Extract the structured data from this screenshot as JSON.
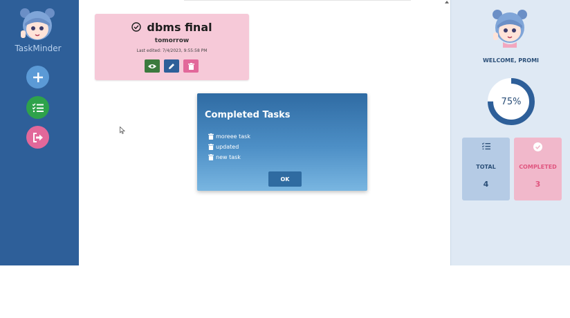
{
  "app": {
    "title": "TaskMinder"
  },
  "sidebar": {
    "buttons": [
      {
        "name": "add",
        "icon": "plus-icon",
        "color": "#5b9ad6"
      },
      {
        "name": "tasks",
        "icon": "checklist-icon",
        "color": "#2ea24b"
      },
      {
        "name": "logout",
        "icon": "sign-out-icon",
        "color": "#e2689a"
      }
    ]
  },
  "task_card": {
    "title": "dbms final",
    "due": "tomorrow",
    "edited": "Last edited: 7/4/2023, 9:55:58 PM",
    "status_icon": "check-circle-icon",
    "actions": [
      {
        "name": "view",
        "icon": "eye-icon",
        "color": "#3c7a3e"
      },
      {
        "name": "edit",
        "icon": "pencil-icon",
        "color": "#2e5f99"
      },
      {
        "name": "delete",
        "icon": "trash-icon",
        "color": "#e2689a"
      }
    ]
  },
  "modal": {
    "title": "Completed Tasks",
    "items": [
      "moreee task",
      "updated",
      "new task"
    ],
    "ok_label": "OK"
  },
  "profile": {
    "welcome": "WELCOME, PROMI",
    "progress_percent": 75,
    "progress_label": "75%"
  },
  "stats": {
    "total": {
      "label": "TOTAL",
      "value": "4",
      "color": "#2b4f78"
    },
    "completed": {
      "label": "COMPLETED",
      "value": "3",
      "color": "#e0557f"
    }
  }
}
